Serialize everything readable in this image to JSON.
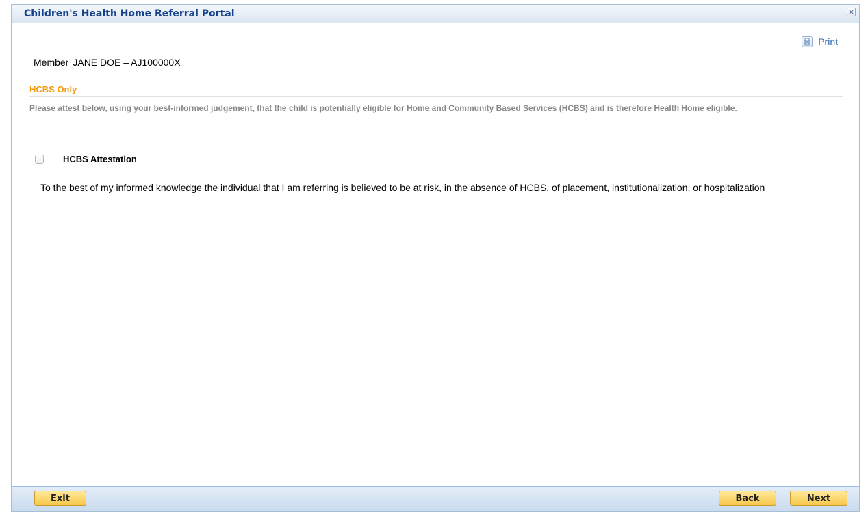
{
  "window": {
    "title": "Children's Health Home Referral Portal"
  },
  "toolbar": {
    "print_label": "Print"
  },
  "member": {
    "label": "Member",
    "value": "JANE DOE – AJ100000X"
  },
  "section": {
    "title": "HCBS Only",
    "instructions": "Please attest below, using your best-informed judgement, that the child is potentially eligible for Home and Community Based Services (HCBS) and is therefore Health Home eligible."
  },
  "attestation": {
    "label": "HCBS Attestation",
    "checked": false,
    "text": "To the best of my informed knowledge the individual that I am referring is believed to be at risk, in the absence of HCBS, of placement, institutionalization, or hospitalization"
  },
  "footer": {
    "exit_label": "Exit",
    "back_label": "Back",
    "next_label": "Next"
  },
  "colors": {
    "title_text": "#15428b",
    "section_title": "#f39c12",
    "button_fill": "#f7c84a",
    "link_text": "#2d6ab0"
  }
}
